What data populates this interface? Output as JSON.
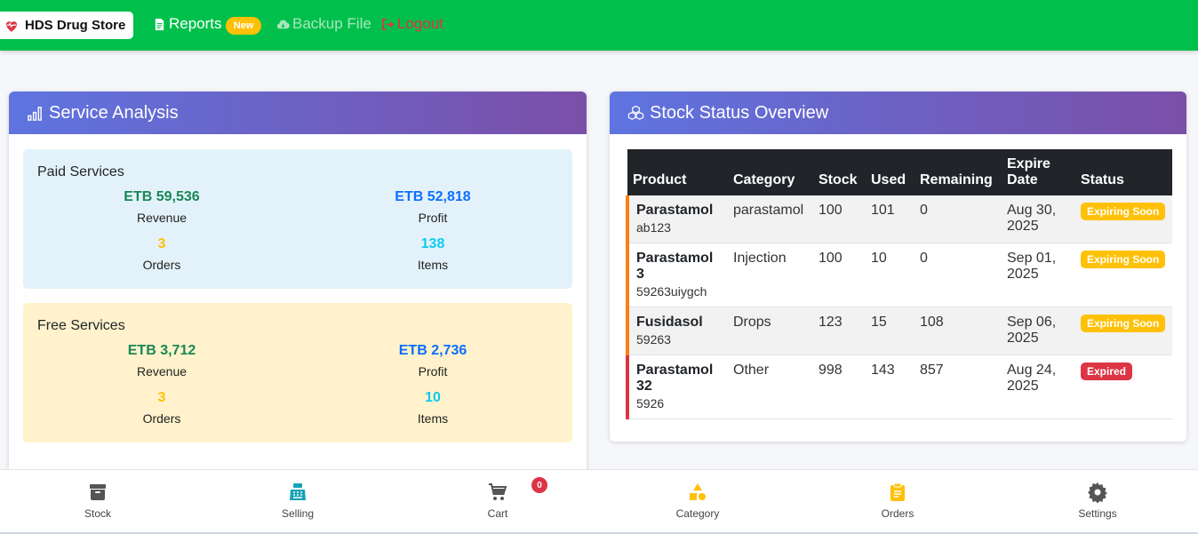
{
  "navbar": {
    "brand": "HDS Drug Store",
    "reports": "Reports",
    "new_badge": "New",
    "backup": "Backup File",
    "logout": "Logout"
  },
  "service": {
    "title": "Service Analysis",
    "paid": {
      "title": "Paid Services",
      "revenue_value": "ETB 59,536",
      "revenue_label": "Revenue",
      "profit_value": "ETB 52,818",
      "profit_label": "Profit",
      "orders_value": "3",
      "orders_label": "Orders",
      "items_value": "138",
      "items_label": "Items"
    },
    "free": {
      "title": "Free Services",
      "revenue_value": "ETB 3,712",
      "revenue_label": "Revenue",
      "profit_value": "ETB 2,736",
      "profit_label": "Profit",
      "orders_value": "3",
      "orders_label": "Orders",
      "items_value": "10",
      "items_label": "Items"
    }
  },
  "stock": {
    "title": "Stock Status Overview",
    "headers": [
      "Product",
      "Category",
      "Stock",
      "Used",
      "Remaining",
      "Expire Date",
      "Status"
    ],
    "rows": [
      {
        "name": "Parastamol",
        "code": "ab123",
        "category": "parastamol",
        "stock": "100",
        "used": "101",
        "remaining": "0",
        "expire": "Aug 30, 2025",
        "status": "Expiring Soon"
      },
      {
        "name": "Parastamol 3",
        "code": "59263uiygch",
        "category": "Injection",
        "stock": "100",
        "used": "10",
        "remaining": "0",
        "expire": "Sep 01, 2025",
        "status": "Expiring Soon"
      },
      {
        "name": "Fusidasol",
        "code": "59263",
        "category": "Drops",
        "stock": "123",
        "used": "15",
        "remaining": "108",
        "expire": "Sep 06, 2025",
        "status": "Expiring Soon"
      },
      {
        "name": "Parastamol 32",
        "code": "5926",
        "category": "Other",
        "stock": "998",
        "used": "143",
        "remaining": "857",
        "expire": "Aug 24, 2025",
        "status": "Expired"
      }
    ]
  },
  "bottom_nav": {
    "stock": "Stock",
    "selling": "Selling",
    "cart": "Cart",
    "cart_count": "0",
    "category": "Category",
    "orders": "Orders",
    "settings": "Settings"
  },
  "colors": {
    "navbar": "#00c04b",
    "header_gradient_start": "#5e74e0",
    "header_gradient_end": "#7b4fa8",
    "expiring": "#ffc107",
    "expired": "#dc3545"
  },
  "icons": [
    "heart-pulse-icon",
    "document-icon",
    "cloud-download-icon",
    "logout-icon",
    "bar-chart-icon",
    "boxes-icon",
    "archive-icon",
    "cash-register-icon",
    "cart-icon",
    "shapes-icon",
    "clipboard-icon",
    "gear-icon"
  ]
}
